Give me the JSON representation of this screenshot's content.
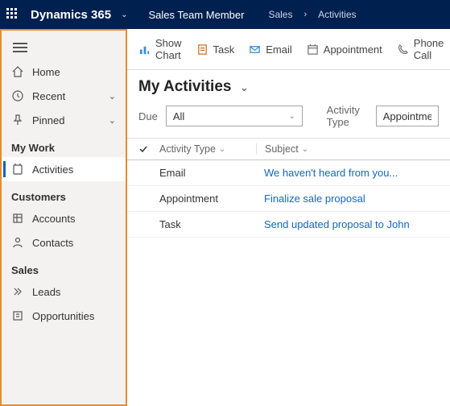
{
  "header": {
    "brand": "Dynamics 365",
    "app": "Sales Team Member",
    "crumb1": "Sales",
    "crumb2": "Activities"
  },
  "sidebar": {
    "top": {
      "home": "Home",
      "recent": "Recent",
      "pinned": "Pinned"
    },
    "sections": {
      "mywork": {
        "title": "My Work",
        "activities": "Activities"
      },
      "customers": {
        "title": "Customers",
        "accounts": "Accounts",
        "contacts": "Contacts"
      },
      "sales": {
        "title": "Sales",
        "leads": "Leads",
        "opportunities": "Opportunities"
      }
    }
  },
  "cmd": {
    "showchart": "Show Chart",
    "task": "Task",
    "email": "Email",
    "appointment": "Appointment",
    "phonecall": "Phone Call"
  },
  "view": {
    "title": "My Activities",
    "due_label": "Due",
    "due_value": "All",
    "activitytype_label": "Activity Type",
    "activitytype_value": "Appointment,C"
  },
  "grid": {
    "cols": {
      "activity_type": "Activity Type",
      "subject": "Subject"
    },
    "rows": [
      {
        "type": "Email",
        "subject": "We haven't heard from you..."
      },
      {
        "type": "Appointment",
        "subject": "Finalize sale proposal"
      },
      {
        "type": "Task",
        "subject": "Send updated proposal to John"
      }
    ]
  }
}
